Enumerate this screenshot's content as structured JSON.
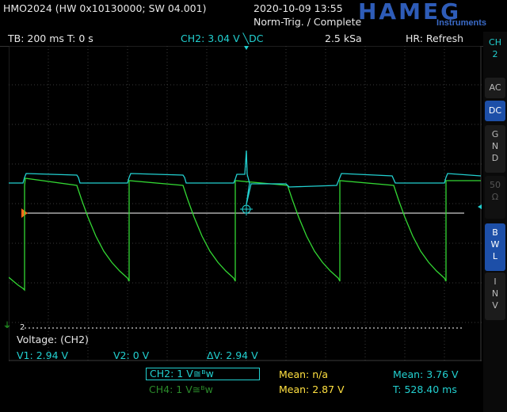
{
  "header": {
    "device": "HMO2024 (HW 0x10130000; SW 04.001)",
    "datetime": "2020-10-09 13:55",
    "trigger_state": "Norm-Trig. / Complete",
    "brand": "HAMEG",
    "brand_sub": "Instruments"
  },
  "status": {
    "timebase": "TB: 200 ms  T: 0 s",
    "channel": "CH2: 3.04 V ╲DC",
    "sample_rate": "2.5 kSa",
    "hr": "HR: Refresh"
  },
  "sidebar": {
    "title": "CH\n2",
    "items": [
      {
        "label": "AC",
        "active": false
      },
      {
        "label": "DC",
        "active": true
      },
      {
        "label": "G\nN\nD",
        "active": false
      },
      {
        "label": "50\nΩ",
        "active": false
      },
      {
        "label": "B\nW\nL",
        "active": true
      },
      {
        "label": "I\nN\nV",
        "active": false
      }
    ]
  },
  "cursor": {
    "title": "Voltage: (CH2)",
    "v1": "V1: 2.94 V",
    "v2": "V2: 0 V",
    "dv": "ΔV: 2.94 V",
    "marker_2": "2"
  },
  "bottom": {
    "ch2": "CH2: 1 V≅ᴮw",
    "ch4": "CH4: 1 V≅ᴮw",
    "mean1": "Mean: n/a",
    "mean2": "Mean: 2.87 V",
    "mean3": "Mean: 3.76 V",
    "period": "T: 528.40 ms"
  },
  "colors": {
    "cyan": "#22d0d0",
    "green": "#33d733",
    "cursor_line": "#ffffff",
    "trigger": "#ff6a1a",
    "yellow": "#ffe040"
  }
}
